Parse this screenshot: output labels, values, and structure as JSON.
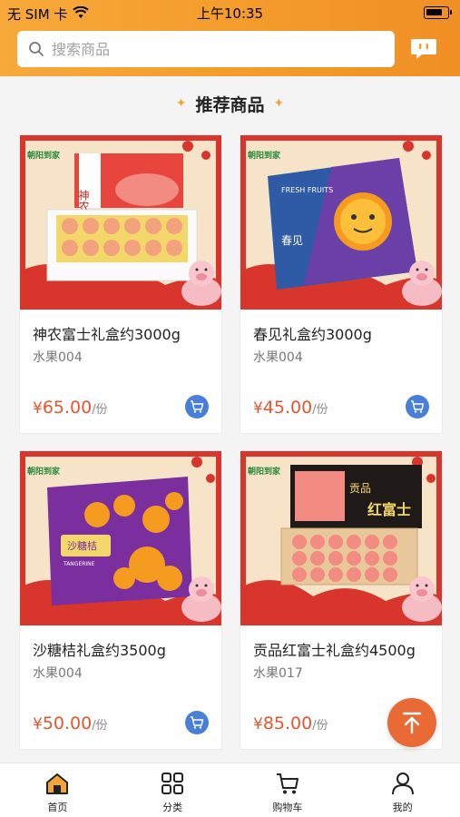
{
  "status_bar": {
    "carrier": "无 SIM 卡",
    "time": "上午10:35",
    "battery_level": 0.8
  },
  "search": {
    "placeholder": "搜索商品"
  },
  "section": {
    "title": "推荐商品"
  },
  "products": [
    {
      "name": "神农富士礼盒约3000g",
      "sku": "水果004",
      "currency": "¥",
      "price": "65.00",
      "unit": "/份",
      "badge": "朝阳到家",
      "box_text": "神农富士",
      "box_color": "#e8453c"
    },
    {
      "name": "春见礼盒约3000g",
      "sku": "水果004",
      "currency": "¥",
      "price": "45.00",
      "unit": "/份",
      "badge": "朝阳到家",
      "box_text": "春见",
      "box_brand": "FRESH FRUITS",
      "box_color": "#6b3fa8"
    },
    {
      "name": "沙糖桔礼盒约3500g",
      "sku": "水果004",
      "currency": "¥",
      "price": "50.00",
      "unit": "/份",
      "badge": "朝阳到家",
      "box_text": "沙糖桔",
      "box_sub": "TANGERINE",
      "box_color": "#7b2f9e"
    },
    {
      "name": "贡品红富士礼盒约4500g",
      "sku": "水果017",
      "currency": "¥",
      "price": "85.00",
      "unit": "/份",
      "badge": "朝阳到家",
      "box_text": "红富士",
      "box_sub": "贡品",
      "box_color": "#1f1a17"
    }
  ],
  "tabbar": [
    {
      "label": "首页",
      "icon": "home-icon",
      "active": true
    },
    {
      "label": "分类",
      "icon": "category-icon",
      "active": false
    },
    {
      "label": "购物车",
      "icon": "cart-icon",
      "active": false
    },
    {
      "label": "我的",
      "icon": "user-icon",
      "active": false
    }
  ],
  "colors": {
    "header": "#f39a2a",
    "price": "#e8552b",
    "cart_button": "#4a7fd8",
    "scroll_top": "#ea6a36",
    "card_bg": "#f6e3c8",
    "card_frame": "#d8362c"
  }
}
